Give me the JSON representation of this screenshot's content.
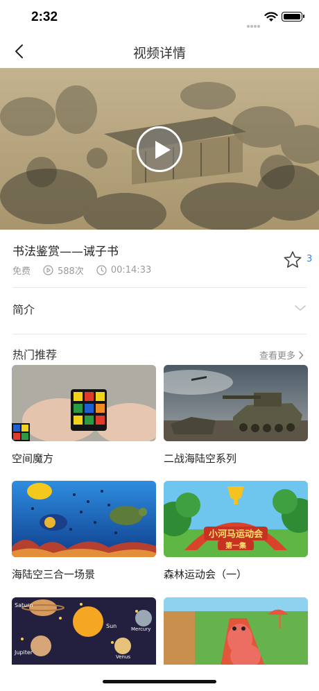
{
  "status_bar": {
    "time": "2:32"
  },
  "nav": {
    "title": "视频详情"
  },
  "video": {
    "title": "书法鉴赏——诫子书",
    "price": "免费",
    "plays": "588次",
    "duration": "00:14:33",
    "favorites": "3"
  },
  "intro": {
    "label": "简介"
  },
  "recommend": {
    "title": "热门推荐",
    "more": "查看更多",
    "items": [
      {
        "label": "空间魔方",
        "thumb": "rubiks-cube"
      },
      {
        "label": "二战海陆空系列",
        "thumb": "tank"
      },
      {
        "label": "海陆空三合一场景",
        "thumb": "ocean-reef"
      },
      {
        "label": "森林运动会（一）",
        "thumb": "forest-games"
      },
      {
        "label": "",
        "thumb": "planets"
      },
      {
        "label": "",
        "thumb": "hippo-track"
      }
    ],
    "forest_banner": "小河马运动会",
    "forest_sub": "第一集",
    "planet_names": [
      "Saturn",
      "Sun",
      "Mercury",
      "Jupiter",
      "Venus"
    ]
  },
  "colors": {
    "accent": "#2f7ff2",
    "divider": "#e6e6e6",
    "muted": "#9a9a9a"
  }
}
